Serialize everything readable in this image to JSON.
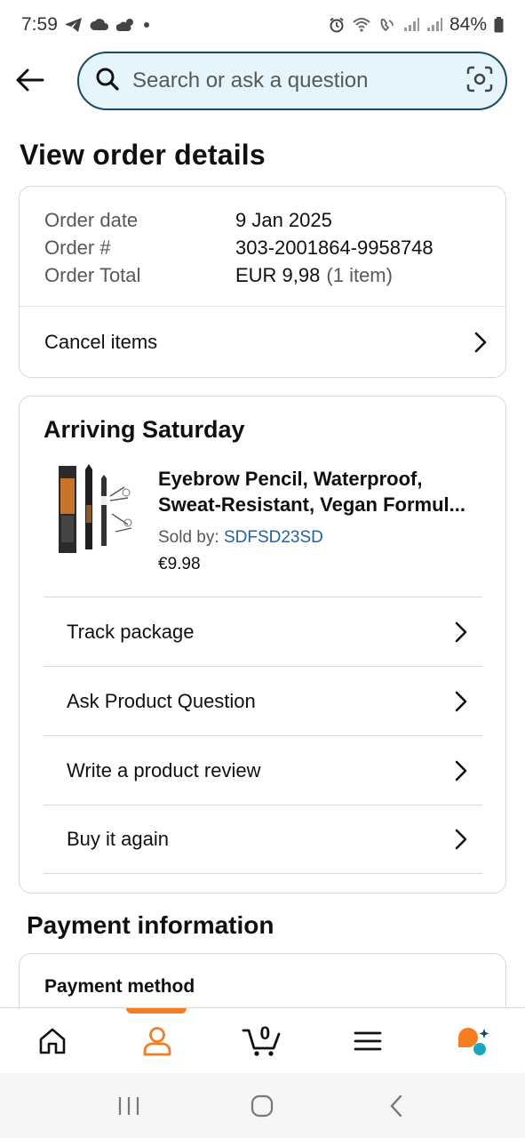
{
  "status_bar": {
    "time": "7:59",
    "battery": "84%"
  },
  "search": {
    "placeholder": "Search or ask a question"
  },
  "page": {
    "title": "View order details"
  },
  "order_summary": {
    "rows": [
      {
        "label": "Order date",
        "value": "9 Jan 2025"
      },
      {
        "label": "Order #",
        "value": "303-2001864-9958748"
      },
      {
        "label": "Order Total",
        "value": "EUR 9,98",
        "extra": "(1 item)"
      }
    ],
    "cancel_label": "Cancel items"
  },
  "shipment": {
    "title": "Arriving Saturday",
    "product": {
      "title_line1": "Eyebrow Pencil, Waterproof,",
      "title_line2": "Sweat-Resistant, Vegan Formul...",
      "sold_by_label": "Sold by:",
      "seller": "SDFSD23SD",
      "price": "€9.98"
    },
    "actions": [
      {
        "label": "Track package"
      },
      {
        "label": "Ask Product Question"
      },
      {
        "label": "Write a product review"
      },
      {
        "label": "Buy it again"
      }
    ]
  },
  "payment": {
    "section_title": "Payment information",
    "method_label": "Payment method"
  },
  "tab_bar": {
    "cart_count": "0",
    "active_tab": "account",
    "accent_color": "#f47c21"
  },
  "colors": {
    "search_border": "#1c4a5f",
    "search_bg": "#e6f5fb",
    "link": "#2162a1",
    "ai_badge_orange": "#f47c21",
    "ai_badge_teal": "#1aa5c0"
  }
}
